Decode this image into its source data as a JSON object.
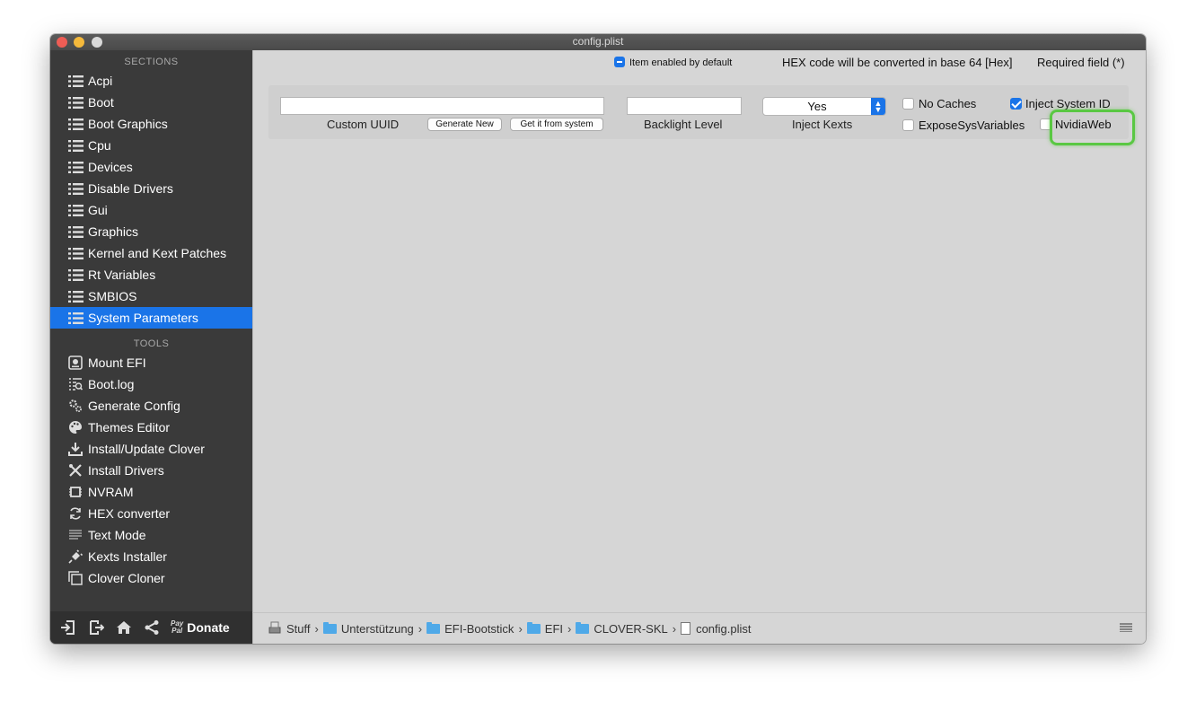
{
  "window": {
    "title": "config.plist"
  },
  "sidebar": {
    "sections_header": "SECTIONS",
    "sections": [
      {
        "label": "Acpi"
      },
      {
        "label": "Boot"
      },
      {
        "label": "Boot Graphics"
      },
      {
        "label": "Cpu"
      },
      {
        "label": "Devices"
      },
      {
        "label": "Disable Drivers"
      },
      {
        "label": "Gui"
      },
      {
        "label": "Graphics"
      },
      {
        "label": "Kernel and Kext Patches"
      },
      {
        "label": "Rt Variables"
      },
      {
        "label": "SMBIOS"
      },
      {
        "label": "System Parameters",
        "selected": true
      }
    ],
    "tools_header": "TOOLS",
    "tools": [
      {
        "label": "Mount EFI",
        "icon": "disk-icon"
      },
      {
        "label": "Boot.log",
        "icon": "log-icon"
      },
      {
        "label": "Generate Config",
        "icon": "gears-icon"
      },
      {
        "label": "Themes Editor",
        "icon": "palette-icon"
      },
      {
        "label": "Install/Update Clover",
        "icon": "download-icon"
      },
      {
        "label": "Install Drivers",
        "icon": "tools-icon"
      },
      {
        "label": "NVRAM",
        "icon": "chip-icon"
      },
      {
        "label": "HEX converter",
        "icon": "refresh-icon"
      },
      {
        "label": "Text Mode",
        "icon": "text-lines-icon"
      },
      {
        "label": "Kexts Installer",
        "icon": "plug-icon"
      },
      {
        "label": "Clover Cloner",
        "icon": "clone-icon"
      }
    ],
    "bottom": {
      "paypal_top": "Pay",
      "paypal_bottom": "Pal",
      "donate": "Donate"
    }
  },
  "header": {
    "item_enabled": "Item enabled by default",
    "hex_note": "HEX code will be converted in base 64 [Hex]",
    "required": "Required field (*)"
  },
  "form": {
    "custom_uuid": {
      "label": "Custom UUID",
      "value": ""
    },
    "generate_new": "Generate New",
    "get_from_system": "Get it from system",
    "backlight": {
      "label": "Backlight Level",
      "value": ""
    },
    "inject_kexts": {
      "label": "Inject Kexts",
      "value": "Yes"
    },
    "no_caches": {
      "label": "No Caches",
      "checked": false
    },
    "inject_system_id": {
      "label": "Inject System ID",
      "checked": true
    },
    "expose_sys_variables": {
      "label": "ExposeSysVariables",
      "checked": false
    },
    "nvidia_web": {
      "label": "NvidiaWeb",
      "checked": false
    },
    "highlight_color": "#5ac843"
  },
  "statusbar": {
    "crumbs": [
      "Stuff",
      "Unterstützung",
      "EFI-Bootstick",
      "EFI",
      "CLOVER-SKL",
      "config.plist"
    ],
    "separator": "›"
  },
  "colors": {
    "accent": "#1a74e8",
    "sidebar": "#3a3a3a"
  }
}
